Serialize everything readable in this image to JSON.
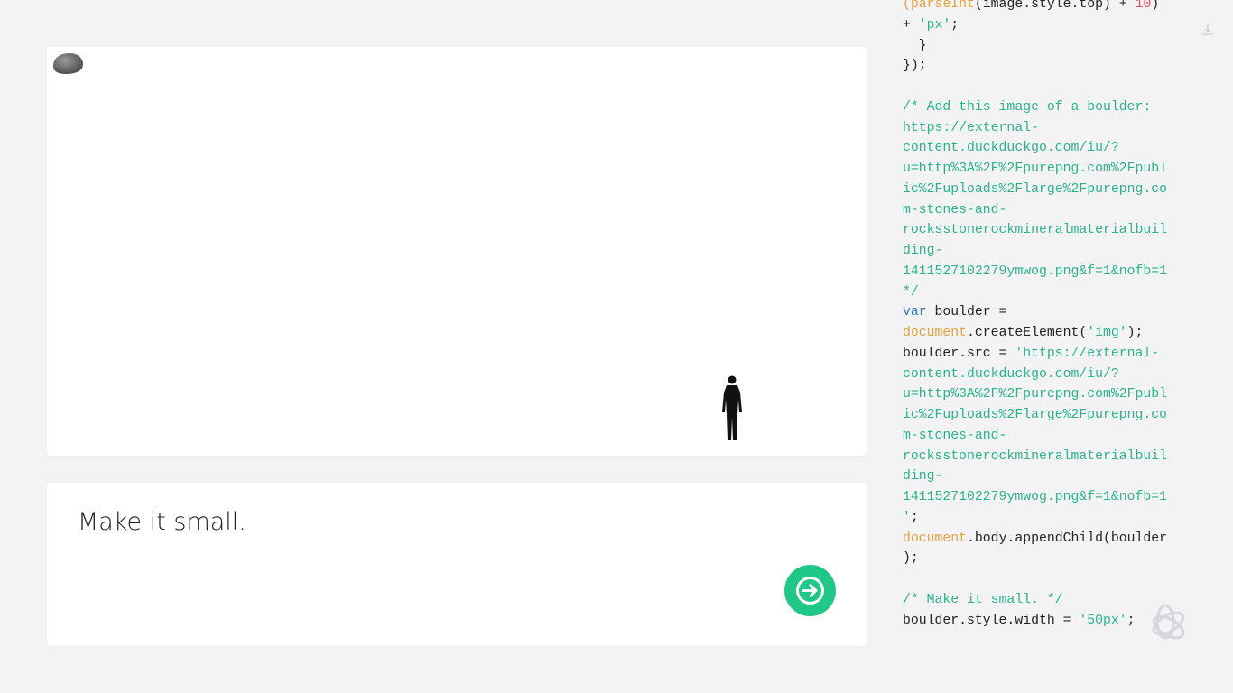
{
  "prompt": {
    "text": "Make it small."
  },
  "code_lines": [
    [
      [
        "f",
        "(parseInt"
      ],
      [
        "p",
        "(image.style.top) + "
      ],
      [
        "n",
        "10"
      ],
      [
        "p",
        ")"
      ]
    ],
    [
      [
        "p",
        "+ "
      ],
      [
        "s",
        "'px'"
      ],
      [
        "p",
        ";"
      ]
    ],
    [
      [
        "p",
        "  }"
      ]
    ],
    [
      [
        "p",
        "});"
      ]
    ],
    [
      [
        "p",
        ""
      ]
    ],
    [
      [
        "c",
        "/* Add this image of a boulder:"
      ]
    ],
    [
      [
        "c",
        "https://external-"
      ]
    ],
    [
      [
        "c",
        "content.duckduckgo.com/iu/?"
      ]
    ],
    [
      [
        "c",
        "u=http%3A%2F%2Fpurepng.com%2Fpubl"
      ]
    ],
    [
      [
        "c",
        "ic%2Fuploads%2Flarge%2Fpurepng.co"
      ]
    ],
    [
      [
        "c",
        "m-stones-and-"
      ]
    ],
    [
      [
        "c",
        "rocksstonerockmineralmaterialbuil"
      ]
    ],
    [
      [
        "c",
        "ding-"
      ]
    ],
    [
      [
        "c",
        "1411527102279ymwog.png&f=1&nofb=1"
      ]
    ],
    [
      [
        "c",
        "*/"
      ]
    ],
    [
      [
        "k",
        "var"
      ],
      [
        "p",
        " boulder ="
      ]
    ],
    [
      [
        "f",
        "document"
      ],
      [
        "p",
        ".createElement("
      ],
      [
        "s",
        "'img'"
      ],
      [
        "p",
        ");"
      ]
    ],
    [
      [
        "p",
        "boulder.src = "
      ],
      [
        "s",
        "'https://external-"
      ]
    ],
    [
      [
        "s",
        "content.duckduckgo.com/iu/?"
      ]
    ],
    [
      [
        "s",
        "u=http%3A%2F%2Fpurepng.com%2Fpubl"
      ]
    ],
    [
      [
        "s",
        "ic%2Fuploads%2Flarge%2Fpurepng.co"
      ]
    ],
    [
      [
        "s",
        "m-stones-and-"
      ]
    ],
    [
      [
        "s",
        "rocksstonerockmineralmaterialbuil"
      ]
    ],
    [
      [
        "s",
        "ding-"
      ]
    ],
    [
      [
        "s",
        "1411527102279ymwog.png&f=1&nofb=1"
      ]
    ],
    [
      [
        "s",
        "'"
      ],
      [
        "p",
        ";"
      ]
    ],
    [
      [
        "f",
        "document"
      ],
      [
        "p",
        ".body.appendChild(boulder"
      ]
    ],
    [
      [
        "p",
        ");"
      ]
    ],
    [
      [
        "p",
        ""
      ]
    ],
    [
      [
        "c",
        "/* Make it small. */"
      ]
    ],
    [
      [
        "p",
        "boulder.style.width = "
      ],
      [
        "s",
        "'50px'"
      ],
      [
        "p",
        ";"
      ]
    ]
  ],
  "colors": {
    "accent": "#20c787",
    "background": "#f3f3f5"
  },
  "icons": {
    "send": "arrow-right-icon",
    "download": "download-icon",
    "logo": "openai-logo-icon"
  }
}
